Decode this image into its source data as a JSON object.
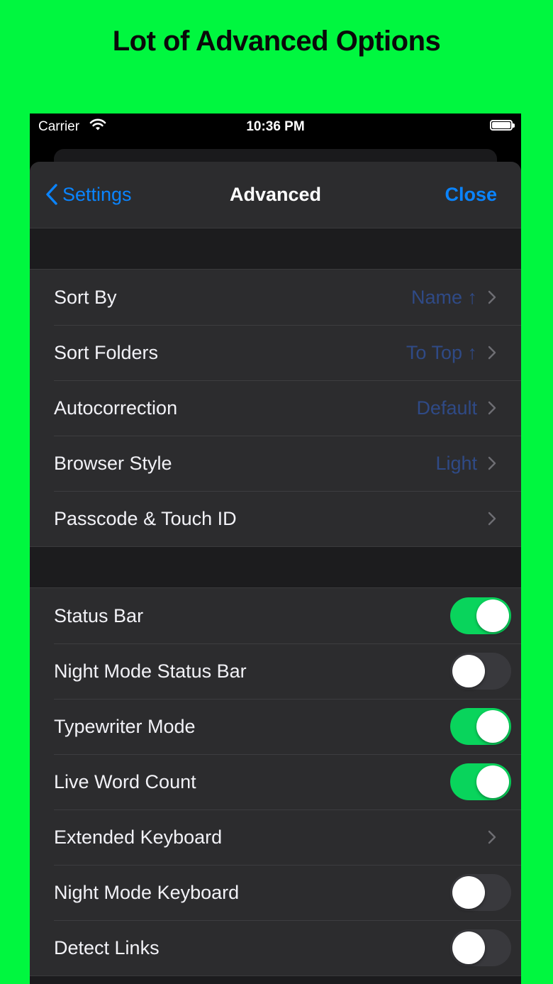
{
  "headline": "Lot of Advanced Options",
  "status_bar": {
    "carrier": "Carrier",
    "time": "10:36 PM"
  },
  "nav": {
    "back_label": "Settings",
    "title": "Advanced",
    "close_label": "Close"
  },
  "group1": [
    {
      "label": "Sort By",
      "value": "Name ↑"
    },
    {
      "label": "Sort Folders",
      "value": "To Top ↑"
    },
    {
      "label": "Autocorrection",
      "value": "Default"
    },
    {
      "label": "Browser Style",
      "value": "Light"
    },
    {
      "label": "Passcode & Touch ID",
      "value": ""
    }
  ],
  "group2": [
    {
      "label": "Status Bar",
      "control": "toggle",
      "on": true
    },
    {
      "label": "Night Mode Status Bar",
      "control": "toggle",
      "on": false
    },
    {
      "label": "Typewriter Mode",
      "control": "toggle",
      "on": true
    },
    {
      "label": "Live Word Count",
      "control": "toggle",
      "on": true
    },
    {
      "label": "Extended Keyboard",
      "control": "chevron"
    },
    {
      "label": "Night Mode Keyboard",
      "control": "toggle",
      "on": false
    },
    {
      "label": "Detect Links",
      "control": "toggle",
      "on": false
    }
  ],
  "colors": {
    "background": "#00f73f",
    "accent": "#0a84ff",
    "toggle_on": "#09d45c",
    "value_text": "#2f4a86"
  },
  "icons": [
    "wifi-icon",
    "battery-icon",
    "chevron-left-icon",
    "chevron-right-icon"
  ]
}
